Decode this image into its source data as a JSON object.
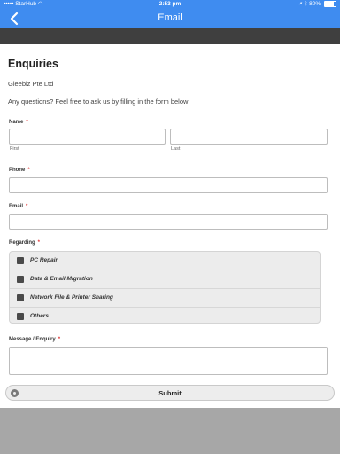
{
  "status_bar": {
    "carrier": "StarHub",
    "time": "2:53 pm",
    "battery": "80%"
  },
  "nav": {
    "title": "Email",
    "back_icon": "chevron-left-icon"
  },
  "form": {
    "title": "Enquiries",
    "company": "Gleebiz Pte Ltd",
    "intro": "Any questions? Feel free to ask us by filling in the form below!",
    "name": {
      "label": "Name",
      "required_mark": "*",
      "first_sublabel": "First",
      "last_sublabel": "Last",
      "first_value": "",
      "last_value": ""
    },
    "phone": {
      "label": "Phone",
      "required_mark": "*",
      "value": ""
    },
    "email": {
      "label": "Email",
      "required_mark": "*",
      "value": ""
    },
    "regarding": {
      "label": "Regarding",
      "required_mark": "*",
      "options": [
        {
          "label": "PC Repair",
          "checked": false
        },
        {
          "label": "Data & Email Migration",
          "checked": false
        },
        {
          "label": "Network File & Printer Sharing",
          "checked": false
        },
        {
          "label": "Others",
          "checked": false
        }
      ]
    },
    "message": {
      "label": "Message / Enquiry",
      "required_mark": "*",
      "value": ""
    },
    "submit_label": "Submit"
  },
  "colors": {
    "header": "#3f8cf0",
    "dark_band": "#3f3f3f",
    "background": "#a7a7a7"
  }
}
